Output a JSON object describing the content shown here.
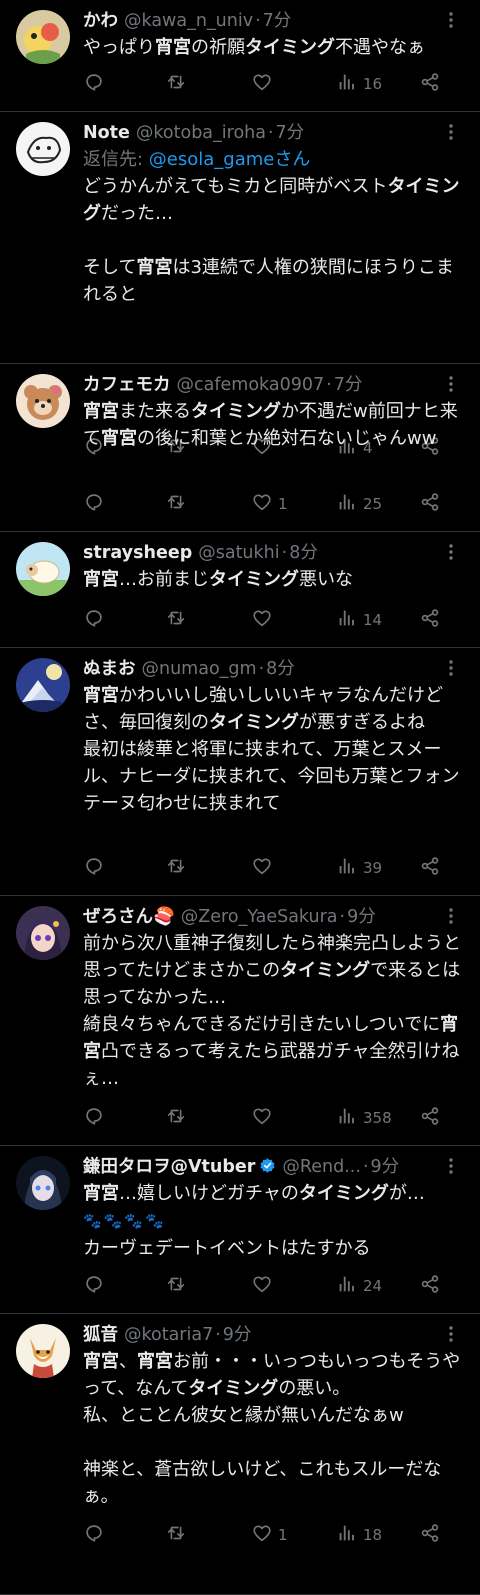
{
  "tweets": [
    {
      "name": "かわ",
      "handle": "@kawa_n_univ",
      "time": "7分",
      "body": [
        {
          "t": "やっぱり"
        },
        {
          "t": "宵宮",
          "b": 1
        },
        {
          "t": "の祈願"
        },
        {
          "t": "タイミング",
          "b": 1
        },
        {
          "t": "不遇やなぁ"
        }
      ],
      "replies": "",
      "retweets": "",
      "likes": "",
      "views": "16"
    },
    {
      "name": "Note",
      "handle": "@kotoba_iroha",
      "time": "7分",
      "reply_label": "返信先: ",
      "reply_to": "@esola_gameさん",
      "body": [
        {
          "t": "どうかんがえてもミカと同時がベスト"
        },
        {
          "t": "タイミング",
          "b": 1
        },
        {
          "t": "だった…\n\nそして"
        },
        {
          "t": "宵宮",
          "b": 1
        },
        {
          "t": "は3連続で人権の狭間にほうりこまれると"
        }
      ],
      "replies": "",
      "retweets": "",
      "likes": "",
      "views": "4"
    },
    {
      "name": "カフェモカ",
      "handle": "@cafemoka0907",
      "time": "7分",
      "body": [
        {
          "t": "宵宮",
          "b": 1
        },
        {
          "t": "また来る"
        },
        {
          "t": "タイミング",
          "b": 1
        },
        {
          "t": "か不遇だw前回ナヒ来て"
        },
        {
          "t": "宵宮",
          "b": 1
        },
        {
          "t": "の後に和葉とか絶対石ないじゃんww"
        }
      ],
      "replies": "",
      "retweets": "",
      "likes": "1",
      "views": "25"
    },
    {
      "name": "straysheep",
      "handle": "@satukhi",
      "time": "8分",
      "body": [
        {
          "t": "宵宮",
          "b": 1
        },
        {
          "t": "…お前まじ"
        },
        {
          "t": "タイミング",
          "b": 1
        },
        {
          "t": "悪いな"
        }
      ],
      "replies": "",
      "retweets": "",
      "likes": "",
      "views": "14"
    },
    {
      "name": "ぬまお",
      "handle": "@numao_gm",
      "time": "8分",
      "body": [
        {
          "t": "宵宮",
          "b": 1
        },
        {
          "t": "かわいいし強いしいいキャラなんだけどさ、毎回復刻の"
        },
        {
          "t": "タイミング",
          "b": 1
        },
        {
          "t": "が悪すぎるよね\n最初は綾華と将軍に挟まれて、万葉とスメール、ナヒーダに挟まれて、今回も万葉とフォンテーヌ匂わせに挟まれて"
        }
      ],
      "replies": "",
      "retweets": "",
      "likes": "",
      "views": "39"
    },
    {
      "name": "ぜろさん🍣",
      "handle": "@Zero_YaeSakura",
      "time": "9分",
      "body": [
        {
          "t": "前から次八重神子復刻したら神楽完凸しようと思ってたけどまさかこの"
        },
        {
          "t": "タイミング",
          "b": 1
        },
        {
          "t": "で来るとは思ってなかった…\n綺良々ちゃんできるだけ引きたいしついでに"
        },
        {
          "t": "宵宮",
          "b": 1
        },
        {
          "t": "凸できるって考えたら武器ガチャ全然引けねぇ…"
        }
      ],
      "replies": "",
      "retweets": "",
      "likes": "",
      "views": "358"
    },
    {
      "name": "鎌田タロヲ@Vtuber",
      "handle": "@Rend...",
      "time": "9分",
      "verified": true,
      "body": [
        {
          "t": "宵宮",
          "b": 1
        },
        {
          "t": "…嬉しいけどガチャの"
        },
        {
          "t": "タイミング",
          "b": 1
        },
        {
          "t": "が…\n"
        },
        {
          "t": "🐾🐾🐾🐾",
          "e": 1
        },
        {
          "t": "\nカーヴェデートイベントはたすかる"
        }
      ],
      "replies": "",
      "retweets": "",
      "likes": "",
      "views": "24"
    },
    {
      "name": "狐音",
      "handle": "@kotaria7",
      "time": "9分",
      "body": [
        {
          "t": "宵宮",
          "b": 1
        },
        {
          "t": "、"
        },
        {
          "t": "宵宮",
          "b": 1
        },
        {
          "t": "お前・・・いっつもいっつもそうやって、なんて"
        },
        {
          "t": "タイミング",
          "b": 1
        },
        {
          "t": "の悪い。\n私、とことん彼女と縁が無いんだなぁw\n\n神楽と、蒼古欲しいけど、これもスルーだなぁ。"
        }
      ],
      "replies": "",
      "retweets": "",
      "likes": "1",
      "views": "18"
    }
  ],
  "colors": {
    "background": "#000000",
    "text": "#e7e9ea",
    "muted": "#71767b",
    "link": "#1d9bf0",
    "divider": "#2f3336"
  },
  "icons": {
    "reply": "reply-icon",
    "retweet": "retweet-icon",
    "like": "heart-icon",
    "views": "views-icon",
    "share": "share-icon",
    "more": "more-icon",
    "verified": "verified-badge-icon"
  }
}
